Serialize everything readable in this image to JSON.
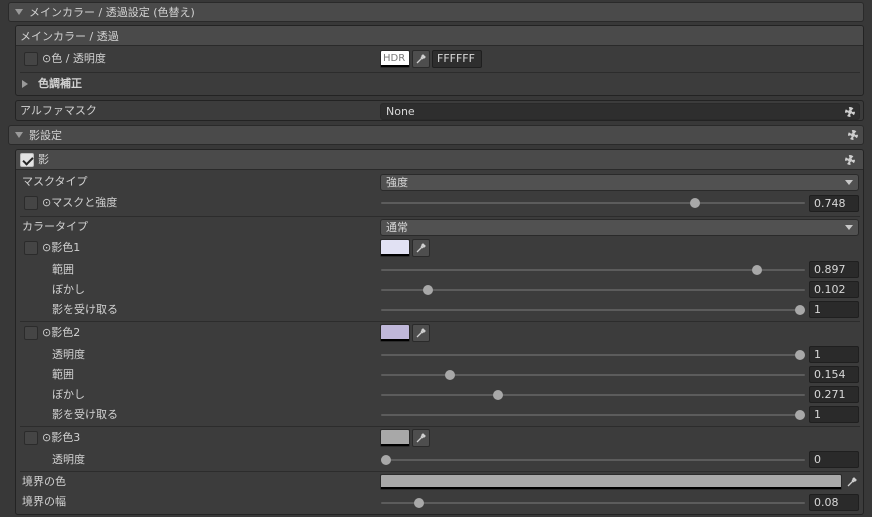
{
  "main_section": {
    "title": "メインカラー / 透過設定 (色替え)"
  },
  "main_color": {
    "header": "メインカラー / 透過",
    "color_label": "⊙色 / 透明度",
    "hdr_label": "HDR",
    "hex_value": "FFFFFF",
    "color_adjust_label": "色調補正"
  },
  "alpha_mask": {
    "label": "アルファマスク",
    "value": "None"
  },
  "shadow_section": {
    "title": "影設定"
  },
  "shadow": {
    "header": "影",
    "mask_type_label": "マスクタイプ",
    "mask_type_value": "強度",
    "mask_strength_label": "⊙マスクと強度",
    "mask_strength_value": "0.748",
    "color_type_label": "カラータイプ",
    "color_type_value": "通常",
    "shadow1": {
      "label": "⊙影色1",
      "color": "#e1e1f3",
      "range_label": "範囲",
      "range_value": "0.897",
      "blur_label": "ぼかし",
      "blur_value": "0.102",
      "receive_label": "影を受け取る",
      "receive_value": "1"
    },
    "shadow2": {
      "label": "⊙影色2",
      "color": "#bfb7d9",
      "opacity_label": "透明度",
      "opacity_value": "1",
      "range_label": "範囲",
      "range_value": "0.154",
      "blur_label": "ぼかし",
      "blur_value": "0.271",
      "receive_label": "影を受け取る",
      "receive_value": "1"
    },
    "shadow3": {
      "label": "⊙影色3",
      "color": "#a8a8a8",
      "opacity_label": "透明度",
      "opacity_value": "0"
    },
    "border_color_label": "境界の色",
    "border_color": "#a8a8a8",
    "border_width_label": "境界の幅",
    "border_width_value": "0.08"
  },
  "colors": {
    "background": "#383838",
    "header_bg": "#4a4a4a",
    "field_bg": "#2a2a2a",
    "slider_thumb": "#a8a8a8"
  },
  "icons": {
    "eyedropper": "eyedropper-icon",
    "gear": "gear-icon",
    "foldout": "triangle-icon"
  }
}
